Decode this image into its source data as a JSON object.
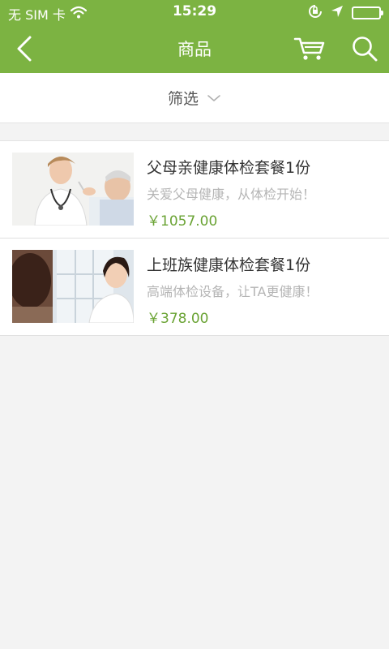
{
  "status_bar": {
    "carrier": "无 SIM 卡",
    "time": "15:29"
  },
  "nav": {
    "title": "商品"
  },
  "filter": {
    "label": "筛选"
  },
  "products": [
    {
      "title": "父母亲健康体检套餐1份",
      "subtitle": "关爱父母健康，从体检开始！",
      "price": "￥1057.00"
    },
    {
      "title": "上班族健康体检套餐1份",
      "subtitle": "高端体检设备，让TA更健康！",
      "price": "￥378.00"
    }
  ],
  "colors": {
    "primary": "#7cb342",
    "price": "#6aa334",
    "background": "#f3f3f3"
  }
}
